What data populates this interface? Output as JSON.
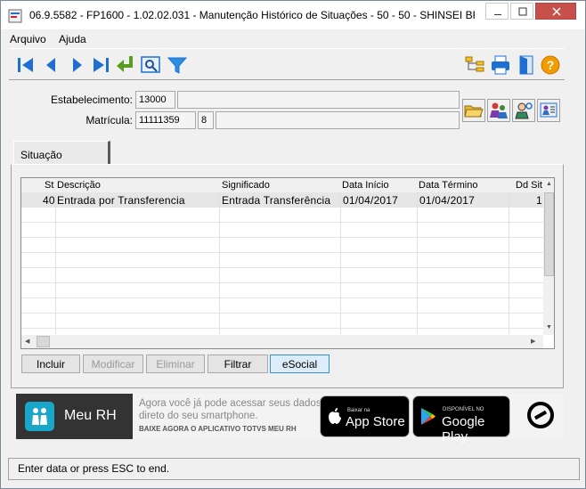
{
  "window": {
    "title": "06.9.5582 - FP1600 - 1.02.02.031 - Manutenção Histórico de Situações - 50 - 50 - SHINSEI BRAS"
  },
  "menu": {
    "arquivo": "Arquivo",
    "ajuda": "Ajuda"
  },
  "toolbar": {
    "left": [
      "first-record-icon",
      "previous-record-icon",
      "next-record-icon",
      "last-record-icon",
      "return-icon",
      "search-icon",
      "filter-icon"
    ],
    "right": [
      "tree-icon",
      "print-icon",
      "exit-icon",
      "help-icon"
    ]
  },
  "header": {
    "estabelecimento_label": "Estabelecimento:",
    "estabelecimento_value": "13000",
    "estabelecimento_name": "",
    "matricula_label": "Matrícula:",
    "matricula_value": "11111359",
    "matricula_digit": "8",
    "matricula_name": ""
  },
  "tab": {
    "label": "Situação"
  },
  "grid": {
    "columns": [
      "St",
      "Descrição",
      "Significado",
      "Data Início",
      "Data Término",
      "Dd Sit"
    ],
    "rows": [
      {
        "st": "40",
        "descricao": "Entrada por Transferencia",
        "significado": "Entrada Transferência",
        "data_inicio": "01/04/2017",
        "data_termino": "01/04/2017",
        "dd_sit": "1"
      }
    ]
  },
  "buttons": {
    "incluir": "Incluir",
    "modificar": "Modificar",
    "eliminar": "Eliminar",
    "filtrar": "Filtrar",
    "esocial": "eSocial"
  },
  "banner": {
    "brand": "Meu RH",
    "line1": "Agora você já pode acessar seus dados",
    "line2": "direto do seu smartphone.",
    "line3": "BAIXE AGORA O APLICATIVO TOTVS MEU RH",
    "appstore_small": "Baixar na",
    "appstore_big": "App Store",
    "googleplay_small": "DISPONÍVEL NO",
    "googleplay_big": "Google Play"
  },
  "status": {
    "text": "Enter data or press ESC to end."
  },
  "colors": {
    "toolbar_blue": "#1f6fd1",
    "accent_green": "#5a9e1f",
    "focus_blue": "#3c8fd1",
    "help_orange": "#f29a00"
  }
}
